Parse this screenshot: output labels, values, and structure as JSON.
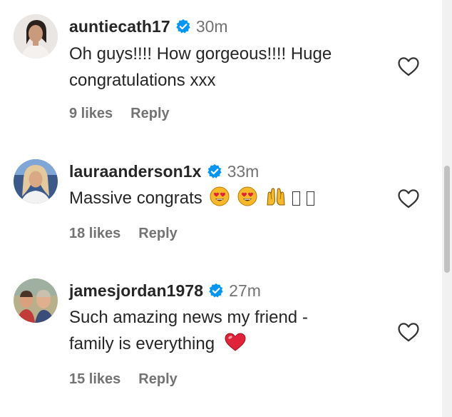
{
  "comments": [
    {
      "username": "auntiecath17",
      "time": "30m",
      "text_lines": [
        "Oh guys!!!! How gorgeous!!!! Huge",
        "congratulations xxx"
      ],
      "likes": "9 likes",
      "reply": "Reply"
    },
    {
      "username": "lauraanderson1x",
      "time": "33m",
      "text_lines": [
        "Massive congrats"
      ],
      "emojis": [
        "heart-eyes-emoji",
        "heart-eyes-emoji",
        "raising-hands-emoji",
        "missing-glyph",
        "missing-glyph"
      ],
      "likes": "18 likes",
      "reply": "Reply"
    },
    {
      "username": "jamesjordan1978",
      "time": "27m",
      "text_lines": [
        "Such amazing news my friend -",
        "family is everything"
      ],
      "emojis": [
        "red-heart-emoji"
      ],
      "likes": "15 likes",
      "reply": "Reply"
    }
  ],
  "colors": {
    "verified": "#0095f6",
    "text": "#262626",
    "secondary": "#737373",
    "heart_emoji": "#e0233b"
  }
}
